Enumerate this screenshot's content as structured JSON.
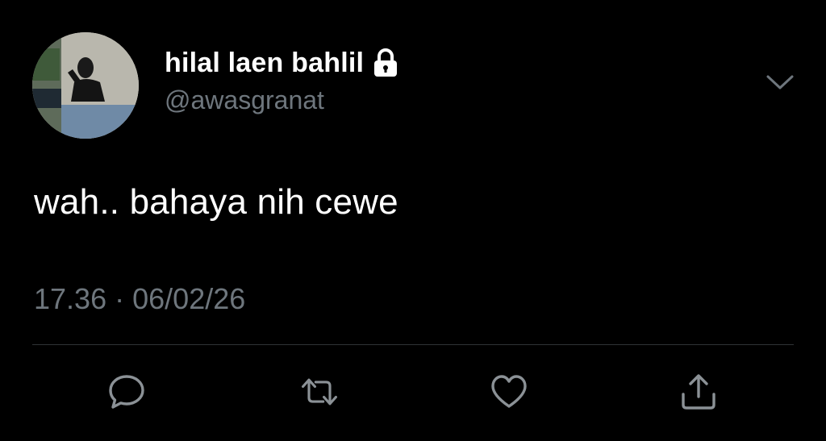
{
  "tweet": {
    "display_name": "hilal laen bahlil",
    "handle": "@awasgranat",
    "protected": true,
    "text": "wah.. bahaya nih cewe",
    "time": "17.36",
    "separator": "·",
    "date": "06/02/26"
  },
  "icons": {
    "lock": "lock-icon",
    "more": "chevron-down-icon",
    "reply": "reply-icon",
    "retweet": "retweet-icon",
    "like": "heart-icon",
    "share": "share-icon"
  },
  "colors": {
    "background": "#000000",
    "text_primary": "#ffffff",
    "text_secondary": "#6e767d",
    "divider": "#2f3336"
  }
}
